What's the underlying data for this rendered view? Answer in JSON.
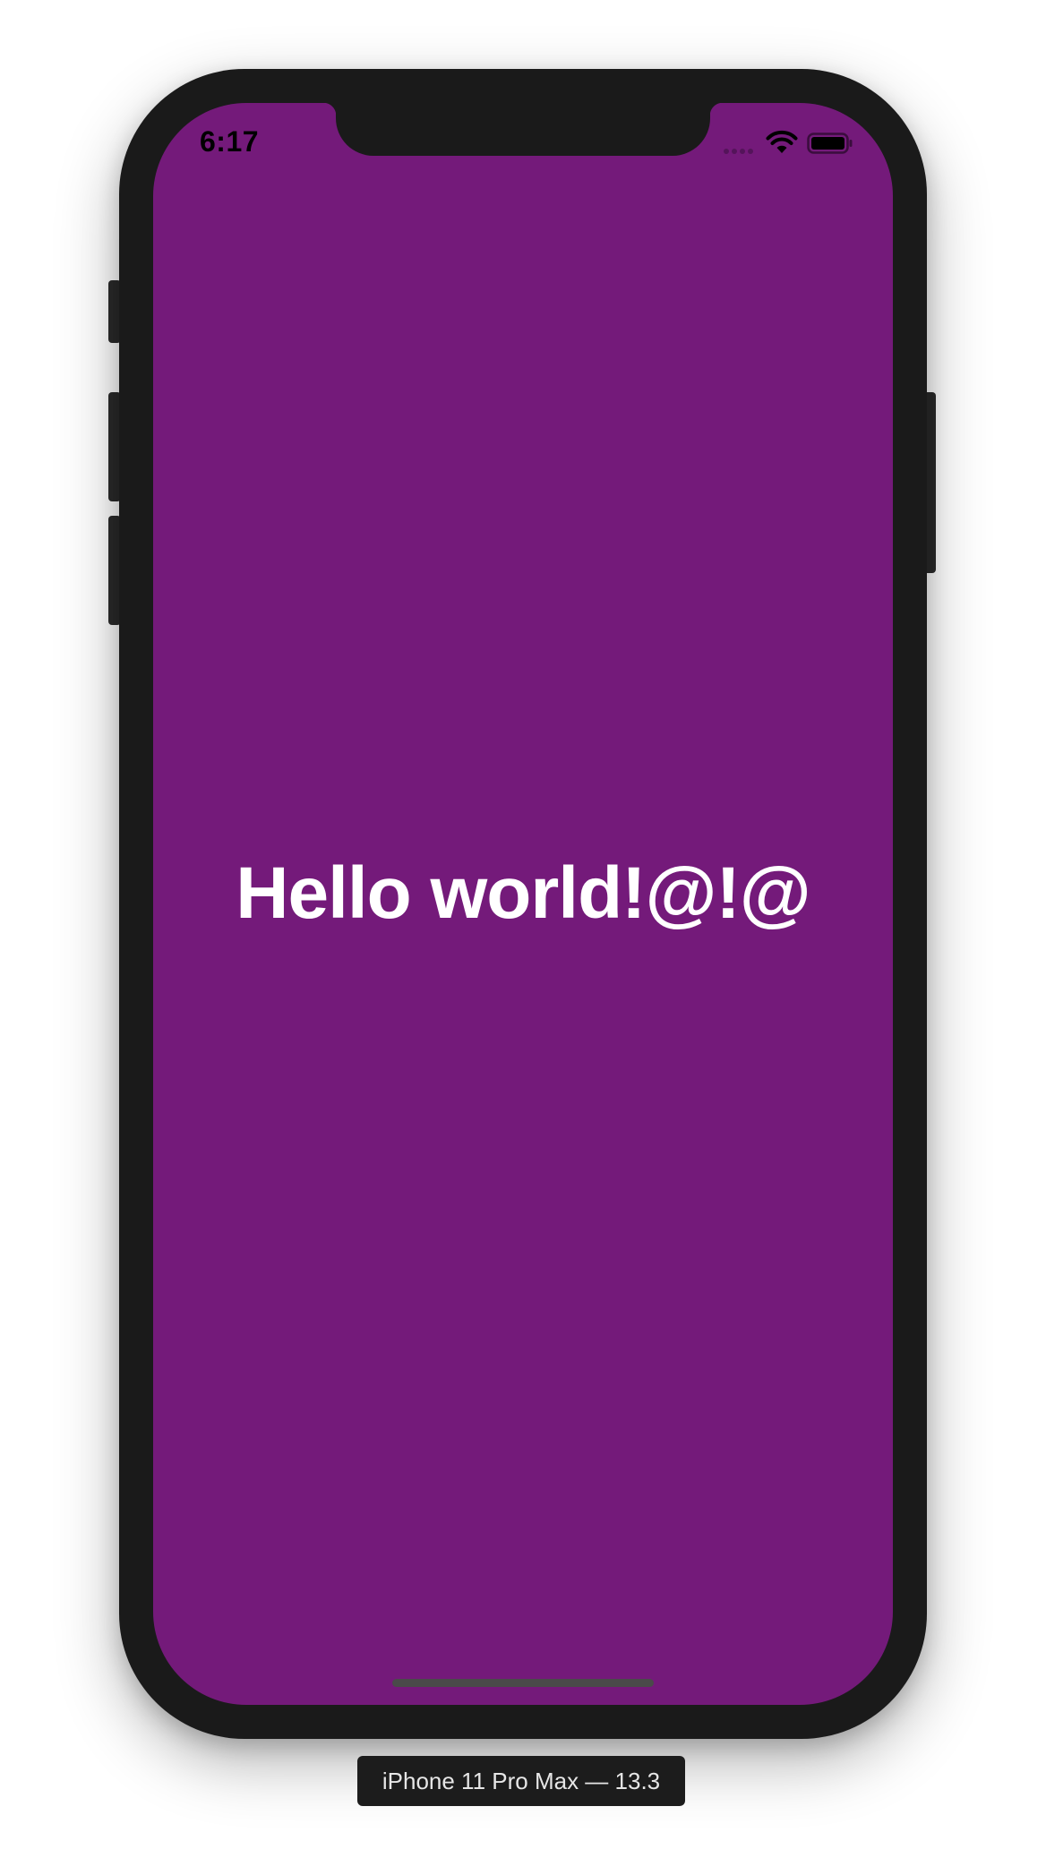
{
  "status_bar": {
    "time": "6:17",
    "icons": [
      "signal-dots-icon",
      "wifi-icon",
      "battery-icon"
    ]
  },
  "app": {
    "background_color": "#741a7a",
    "text_color": "#ffffff",
    "greeting": "Hello world!@!@"
  },
  "simulator": {
    "device_label": "iPhone 11 Pro Max — 13.3"
  }
}
